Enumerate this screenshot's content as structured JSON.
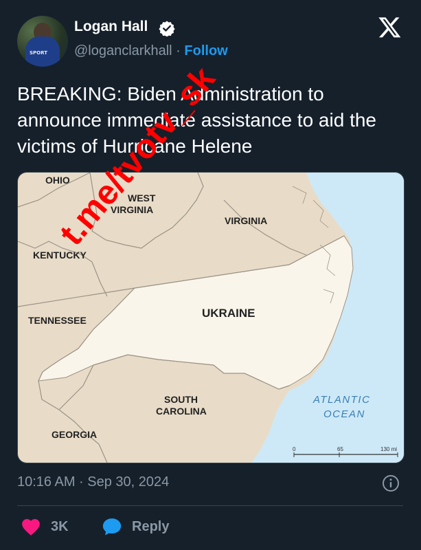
{
  "author": {
    "name": "Logan Hall",
    "handle": "@loganclarkhall",
    "separator": "·",
    "follow_label": "Follow",
    "avatar_text": "SPORT"
  },
  "tweet": {
    "text": "BREAKING: Biden Administration to announce immediate assistance to aid the victims of Hurricane Helene",
    "timestamp": "10:16 AM · Sep 30, 2024"
  },
  "map": {
    "labels": {
      "ohio": "OHIO",
      "west_virginia_1": "WEST",
      "west_virginia_2": "VIRGINIA",
      "virginia": "VIRGINIA",
      "kentucky": "KENTUCKY",
      "tennessee": "TENNESSEE",
      "ukraine": "UKRAINE",
      "south_carolina_1": "SOUTH",
      "south_carolina_2": "CAROLINA",
      "georgia": "GEORGIA",
      "atlantic_1": "ATLANTIC",
      "atlantic_2": "OCEAN"
    },
    "scale": {
      "zero": "0",
      "mid": "65",
      "max": "130 mi"
    },
    "colors": {
      "land": "#e8dcc8",
      "highlight": "#faf5ea",
      "water": "#cde9f7",
      "border": "#9b9285"
    }
  },
  "watermark": {
    "text": "t.me/tvotv_sk",
    "color": "#ff0000"
  },
  "actions": {
    "like_count": "3K",
    "reply_label": "Reply"
  },
  "icons": {
    "verified": "verified-badge-icon",
    "x_logo": "x-logo-icon",
    "info": "info-icon",
    "heart": "heart-icon",
    "reply": "speech-bubble-icon"
  }
}
